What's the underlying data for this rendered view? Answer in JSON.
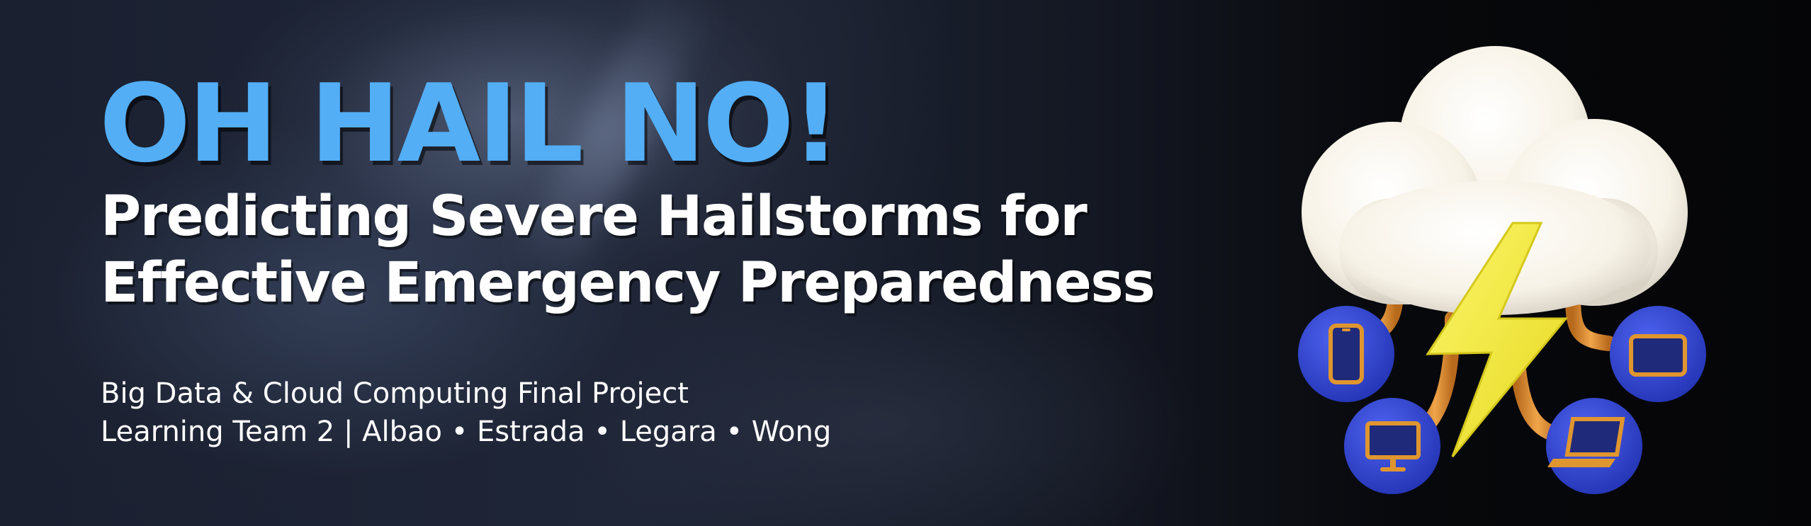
{
  "banner": {
    "headline": "OH HAIL NO!",
    "subtitle_line1": "Predicting Severe Hailstorms for",
    "subtitle_line2": "Effective Emergency Preparedness",
    "course_line": "Big Data & Cloud Computing Final Project",
    "team_line": "Learning Team 2 | Albao • Estrada • Legara • Wong"
  },
  "illustration": {
    "name": "cloud-computing-lightning-illustration",
    "devices": [
      "smartphone-icon",
      "tablet-icon",
      "desktop-monitor-icon",
      "laptop-icon"
    ]
  },
  "colors": {
    "headline": "#53aef5",
    "text": "#ffffff",
    "device_circle": "#2a3fc9",
    "device_screen_frame": "#e0962f",
    "bolt": "#f2ee3a",
    "cloud": "#fbf7ee"
  }
}
